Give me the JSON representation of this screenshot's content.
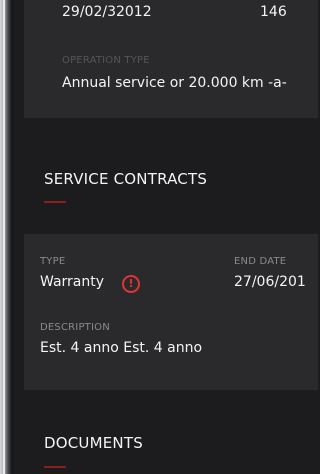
{
  "operation": {
    "date": "29/02/32012",
    "km": "146",
    "type_label": "OPERATION TYPE",
    "type_value": "Annual service or 20.000 km -a-"
  },
  "service_contracts": {
    "title": "SERVICE CONTRACTS",
    "accent_color": "#8f1d1f",
    "type_label": "TYPE",
    "type_value": "Warranty",
    "warning_icon": "!",
    "end_date_label": "END DATE",
    "end_date_value": "27/06/201",
    "description_label": "DESCRIPTION",
    "description_value": "Est. 4 anno Est. 4 anno"
  },
  "documents": {
    "title": "DOCUMENTS"
  }
}
